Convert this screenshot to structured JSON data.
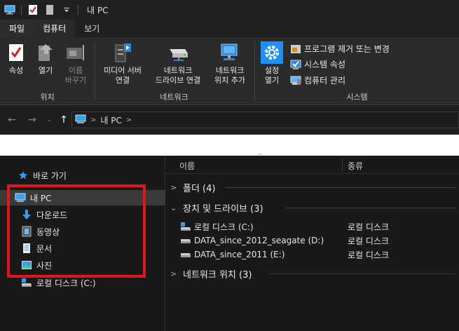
{
  "window": {
    "title": "내 PC"
  },
  "tabs": {
    "file": "파일",
    "computer": "컴퓨터",
    "view": "보기"
  },
  "ribbon": {
    "location": {
      "label": "위치",
      "properties": "속성",
      "open": "열기",
      "rename_line1": "이름",
      "rename_line2": "바꾸기"
    },
    "network": {
      "label": "네트워크",
      "media_line1": "미디어 서버",
      "media_line2": "연결",
      "map_line1": "네트워크",
      "map_line2": "드라이브 연결",
      "add_line1": "네트워크",
      "add_line2": "위치 추가"
    },
    "system": {
      "label": "시스템",
      "settings_line1": "설정",
      "settings_line2": "열기",
      "uninstall": "프로그램 제거 또는 변경",
      "sys_props": "시스템 속성",
      "manage": "컴퓨터 관리"
    }
  },
  "address": {
    "location": "내 PC"
  },
  "navpane": {
    "quick_access": "바로 가기",
    "this_pc": "내 PC",
    "downloads": "다운로드",
    "videos": "동영상",
    "documents": "문서",
    "pictures": "사진",
    "local_disk": "로컬 디스크 (C:)"
  },
  "content": {
    "columns": {
      "name": "이름",
      "type": "종류"
    },
    "groups": {
      "folders": "폴더 (4)",
      "devices": "장치 및 드라이브 (3)",
      "network": "네트워크 위치 (3)"
    },
    "drives": [
      {
        "name": "로컬 디스크 (C:)",
        "type": "로컬 디스크"
      },
      {
        "name": "DATA_since_2012_seagate (D:)",
        "type": "로컬 디스크"
      },
      {
        "name": "DATA_since_2011 (E:)",
        "type": "로컬 디스크"
      }
    ]
  },
  "colors": {
    "highlight": "#e0161f",
    "accent": "#1e90ff"
  }
}
